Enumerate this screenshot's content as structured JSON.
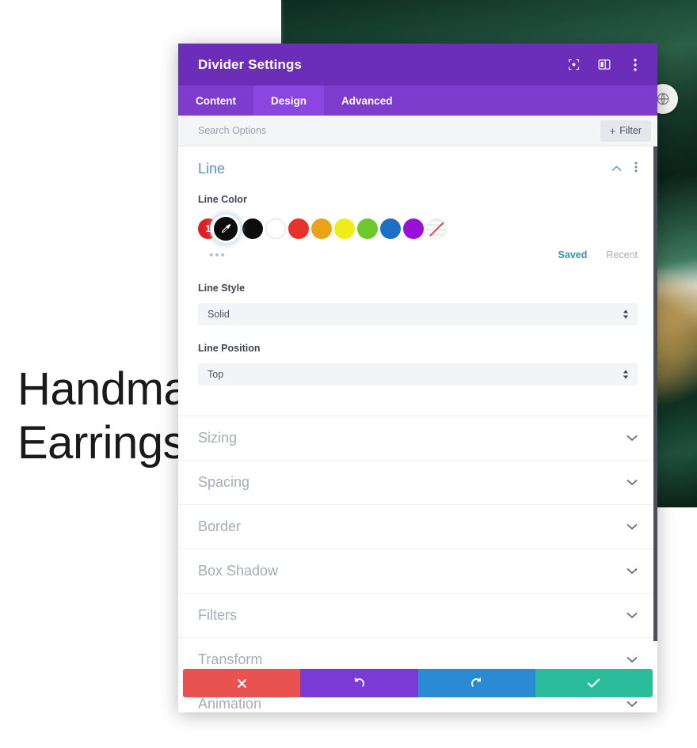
{
  "background": {
    "headline_line1": "Handmade",
    "headline_line2": "Earrings",
    "badge_icon": "globe-icon"
  },
  "modal": {
    "title": "Divider Settings",
    "titlebar_icons": [
      {
        "name": "responsive-preview-icon",
        "glyph": "◙"
      },
      {
        "name": "layout-columns-icon",
        "glyph": "▥"
      },
      {
        "name": "more-options-icon",
        "glyph": "⋮"
      }
    ],
    "tabs": [
      {
        "label": "Content",
        "active": false
      },
      {
        "label": "Design",
        "active": true
      },
      {
        "label": "Advanced",
        "active": false
      }
    ],
    "search": {
      "placeholder": "Search Options",
      "value": ""
    },
    "filter_button": {
      "plus": "+",
      "label": "Filter"
    },
    "open_section": {
      "title": "Line",
      "collapse_icon": "chevron-up-icon",
      "options_icon": "more-options-icon",
      "line_color": {
        "label": "Line Color",
        "active_index": "1",
        "active_swatch_color": "#0d0d0d",
        "active_swatch_icon": "eyedropper-icon",
        "palette": [
          {
            "name": "swatch-black",
            "color": "#0d0d0d"
          },
          {
            "name": "swatch-white",
            "color": "#ffffff"
          },
          {
            "name": "swatch-red",
            "color": "#e8332a"
          },
          {
            "name": "swatch-orange",
            "color": "#e8a317"
          },
          {
            "name": "swatch-yellow",
            "color": "#f0ec18"
          },
          {
            "name": "swatch-green",
            "color": "#6dc82a"
          },
          {
            "name": "swatch-blue",
            "color": "#1b6fc4"
          },
          {
            "name": "swatch-purple",
            "color": "#9b10d8"
          }
        ],
        "transparent_swatch": "swatch-transparent",
        "more_dots": "•••",
        "saved_label": "Saved",
        "recent_label": "Recent"
      },
      "line_style": {
        "label": "Line Style",
        "value": "Solid"
      },
      "line_position": {
        "label": "Line Position",
        "value": "Top"
      }
    },
    "collapsed_sections": [
      {
        "label": "Sizing"
      },
      {
        "label": "Spacing"
      },
      {
        "label": "Border"
      },
      {
        "label": "Box Shadow"
      },
      {
        "label": "Filters"
      },
      {
        "label": "Transform"
      },
      {
        "label": "Animation"
      }
    ],
    "footer_buttons": [
      {
        "name": "cancel-button",
        "icon": "close-icon",
        "glyph": "✖",
        "color": "#e8534f"
      },
      {
        "name": "undo-button",
        "icon": "undo-icon",
        "glyph": "↺",
        "color": "#7b3ad4"
      },
      {
        "name": "redo-button",
        "icon": "redo-icon",
        "glyph": "↻",
        "color": "#2a8ad4"
      },
      {
        "name": "save-button",
        "icon": "check-icon",
        "glyph": "✔",
        "color": "#2bbc9b"
      }
    ]
  }
}
